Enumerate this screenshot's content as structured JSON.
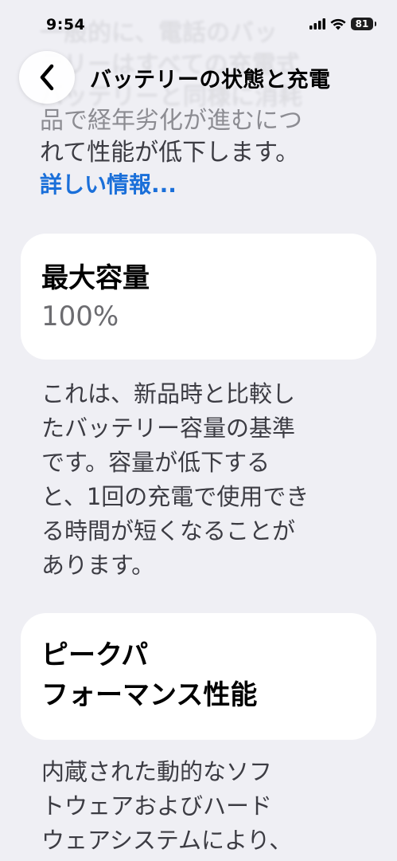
{
  "status_bar": {
    "time": "9:54",
    "battery_level": "81",
    "icons": [
      "cellular-signal-icon",
      "wifi-icon",
      "battery-icon"
    ]
  },
  "background_text": {
    "lines": [
      "一般的に、電話のバッ",
      "テリーはすべての充電式",
      "バッテリーと同様に消耗"
    ]
  },
  "nav": {
    "back_icon": "chevron-left-icon",
    "title": "バッテリーの状態と充電"
  },
  "intro": {
    "lines": [
      "品で経年劣化が進むにつ",
      "れて性能が低下します。"
    ],
    "more_link": "詳しい情報..."
  },
  "capacity_card": {
    "title": "最大容量",
    "value": "100%"
  },
  "capacity_description": {
    "lines": [
      "これは、新品時と比較し",
      "たバッテリー容量の基準",
      "です。容量が低下する",
      "と、1回の充電で使用でき",
      "る時間が短くなることが",
      "あります。"
    ]
  },
  "performance_card": {
    "title_lines": [
      "ピークパ",
      "フォーマンス性能"
    ]
  },
  "performance_description": {
    "lines": [
      "内蔵された動的なソフ",
      "トウェアおよびハード",
      "ウェアシステムにより、"
    ]
  },
  "colors": {
    "background": "#efeff4",
    "card": "#ffffff",
    "link": "#1a6fd9",
    "secondary_text": "#6c6c70"
  }
}
